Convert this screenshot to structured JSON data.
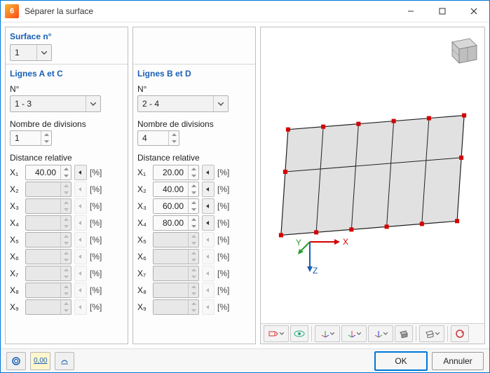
{
  "window": {
    "title": "Séparer la surface"
  },
  "surface": {
    "heading": "Surface n°",
    "value": "1"
  },
  "lineGroups": [
    {
      "title": "Lignes A et C",
      "numberLabel": "N°",
      "numberValue": "1 - 3",
      "divisionsLabel": "Nombre de divisions",
      "divisionsValue": "1",
      "distanceLabel": "Distance relative",
      "unit": "[%]",
      "rows": [
        {
          "label": "X₁",
          "value": "40.00",
          "enabled": true
        },
        {
          "label": "X₂",
          "value": "",
          "enabled": false
        },
        {
          "label": "X₃",
          "value": "",
          "enabled": false
        },
        {
          "label": "X₄",
          "value": "",
          "enabled": false
        },
        {
          "label": "X₅",
          "value": "",
          "enabled": false
        },
        {
          "label": "X₆",
          "value": "",
          "enabled": false
        },
        {
          "label": "X₇",
          "value": "",
          "enabled": false
        },
        {
          "label": "X₈",
          "value": "",
          "enabled": false
        },
        {
          "label": "X₉",
          "value": "",
          "enabled": false
        }
      ]
    },
    {
      "title": "Lignes B et D",
      "numberLabel": "N°",
      "numberValue": "2 - 4",
      "divisionsLabel": "Nombre de divisions",
      "divisionsValue": "4",
      "distanceLabel": "Distance relative",
      "unit": "[%]",
      "rows": [
        {
          "label": "X₁",
          "value": "20.00",
          "enabled": true
        },
        {
          "label": "X₂",
          "value": "40.00",
          "enabled": true
        },
        {
          "label": "X₃",
          "value": "60.00",
          "enabled": true
        },
        {
          "label": "X₄",
          "value": "80.00",
          "enabled": true
        },
        {
          "label": "X₅",
          "value": "",
          "enabled": false
        },
        {
          "label": "X₆",
          "value": "",
          "enabled": false
        },
        {
          "label": "X₇",
          "value": "",
          "enabled": false
        },
        {
          "label": "X₈",
          "value": "",
          "enabled": false
        },
        {
          "label": "X₉",
          "value": "",
          "enabled": false
        }
      ]
    }
  ],
  "axes": {
    "x": "X",
    "y": "Y",
    "z": "Z"
  },
  "buttons": {
    "ok": "OK",
    "cancel": "Annuler"
  },
  "footerIcons": {
    "help": "help-icon",
    "units": "0,00",
    "status": "status-icon"
  },
  "viewToolbar": {
    "items": [
      "view-mode",
      "eye",
      "axis-x",
      "axis-y",
      "axis-z",
      "clipping",
      "wireframe",
      "refresh"
    ]
  }
}
